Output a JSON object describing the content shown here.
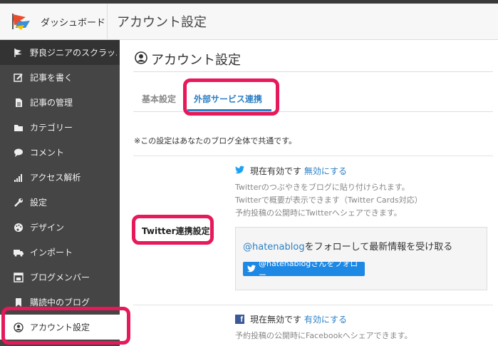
{
  "header": {
    "dashboard_label": "ダッシュボード",
    "page_heading": "アカウント設定"
  },
  "sidebar": {
    "items": [
      {
        "label": "野良ジニアのスクラッ…",
        "icon": "blog-logo-icon"
      },
      {
        "label": "記事を書く",
        "icon": "edit-icon"
      },
      {
        "label": "記事の管理",
        "icon": "document-icon"
      },
      {
        "label": "カテゴリー",
        "icon": "folder-icon"
      },
      {
        "label": "コメント",
        "icon": "comment-icon"
      },
      {
        "label": "アクセス解析",
        "icon": "bar-chart-icon"
      },
      {
        "label": "設定",
        "icon": "wrench-icon"
      },
      {
        "label": "デザイン",
        "icon": "palette-icon"
      },
      {
        "label": "インポート",
        "icon": "truck-icon"
      },
      {
        "label": "ブログメンバー",
        "icon": "members-icon"
      },
      {
        "label": "購読中のブログ",
        "icon": "bookmark-icon"
      },
      {
        "label": "アカウント設定",
        "icon": "user-circle-icon"
      }
    ]
  },
  "main": {
    "title": "アカウント設定",
    "tabs": [
      {
        "label": "基本設定"
      },
      {
        "label": "外部サービス連携"
      }
    ],
    "note": "※この設定はあなたのブログ全体で共通です。",
    "twitter": {
      "section_label": "Twitter連携設定",
      "status_text": "現在有効です",
      "status_action": "無効にする",
      "desc_lines": [
        "Twitterのつぶやきをブログに貼り付けられます。",
        "Twitterで概要が表示できます（Twitter Cards対応）",
        "予約投稿の公開時にTwitterへシェアできます。"
      ],
      "follow_handle": "@hatenablog",
      "follow_text": "をフォローして最新情報を受け取る",
      "follow_button": "@hatenablogさんをフォロー"
    },
    "facebook": {
      "status_text": "現在無効です",
      "status_action": "有効にする",
      "desc": "予約投稿の公開時にFacebookへシェアできます。"
    }
  },
  "colors": {
    "accent": "#2c7fc4",
    "highlight": "#e6195a",
    "sidebar_bg": "#454545",
    "twitter_button": "#1e88e5",
    "facebook": "#3b5998"
  }
}
